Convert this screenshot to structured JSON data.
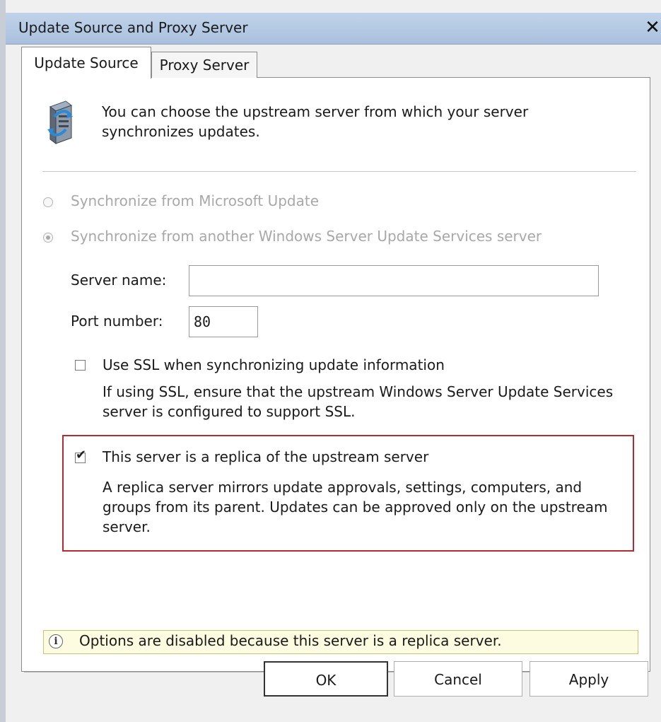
{
  "window": {
    "title": "Update Source and Proxy Server",
    "close_glyph": "✕"
  },
  "tabs": [
    {
      "label": "Update Source",
      "active": true
    },
    {
      "label": "Proxy Server",
      "active": false
    }
  ],
  "header": {
    "icon": "server-icon",
    "text": "You can choose the upstream server from which your server synchronizes updates."
  },
  "options": {
    "microsoft_update_label": "Synchronize from Microsoft Update",
    "microsoft_update_selected": false,
    "wsus_label": "Synchronize from another Windows Server Update Services server",
    "wsus_selected": true
  },
  "fields": {
    "server_name_label": "Server name:",
    "server_name_value": "",
    "port_label": "Port number:",
    "port_value": "80"
  },
  "ssl": {
    "label": "Use SSL when synchronizing update information",
    "checked": false,
    "note": "If using SSL, ensure that the upstream Windows Server Update Services server is configured to support SSL."
  },
  "replica": {
    "label": "This server is a replica of the upstream server",
    "checked": true,
    "note": "A replica server mirrors update approvals, settings, computers, and groups from its parent. Updates can be approved only on the upstream server."
  },
  "info_bar": {
    "icon_glyph": "i",
    "text": "Options are disabled because this server is a replica server."
  },
  "buttons": {
    "ok": "OK",
    "cancel": "Cancel",
    "apply": "Apply"
  },
  "colors": {
    "titlebar": "#b4c8e2",
    "highlight_border": "#b32b33",
    "info_background": "#fdfbe0",
    "disabled_text": "#a8a8a8"
  }
}
